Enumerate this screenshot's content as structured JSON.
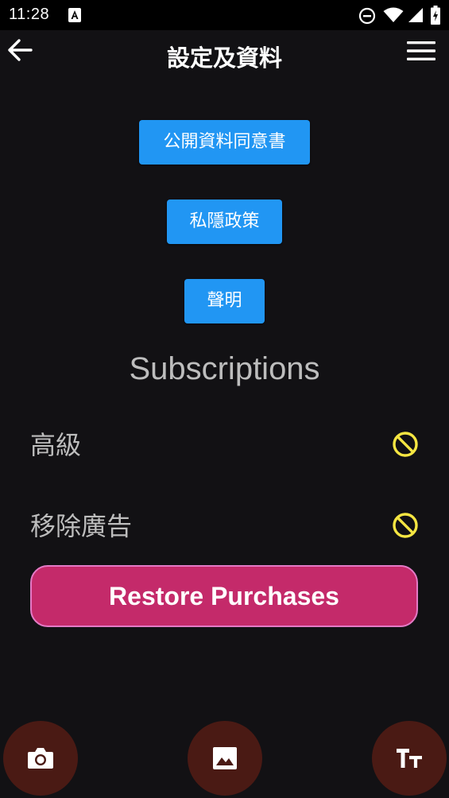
{
  "status_bar": {
    "time": "11:28",
    "icons": [
      "accessibility-icon",
      "do-not-disturb-icon",
      "wifi-icon",
      "signal-icon",
      "battery-icon"
    ]
  },
  "app_bar": {
    "title": "設定及資料",
    "back_icon": "back-arrow-icon",
    "menu_icon": "hamburger-menu-icon"
  },
  "links": [
    {
      "label": "公開資料同意書"
    },
    {
      "label": "私隱政策"
    },
    {
      "label": "聲明"
    }
  ],
  "subscriptions": {
    "title": "Subscriptions",
    "items": [
      {
        "label": "高級",
        "status_icon": "not-subscribed-icon"
      },
      {
        "label": "移除廣告",
        "status_icon": "not-subscribed-icon"
      }
    ],
    "restore_label": "Restore Purchases"
  },
  "fab_buttons": [
    {
      "icon": "camera-icon"
    },
    {
      "icon": "image-icon"
    },
    {
      "icon": "text-size-icon"
    }
  ],
  "colors": {
    "background": "#121114",
    "link_button": "#2196f3",
    "restore_button": "#c42a6a",
    "restore_border": "#e47ac6",
    "status_icon": "#f5e642",
    "fab": "#4a1a14"
  }
}
